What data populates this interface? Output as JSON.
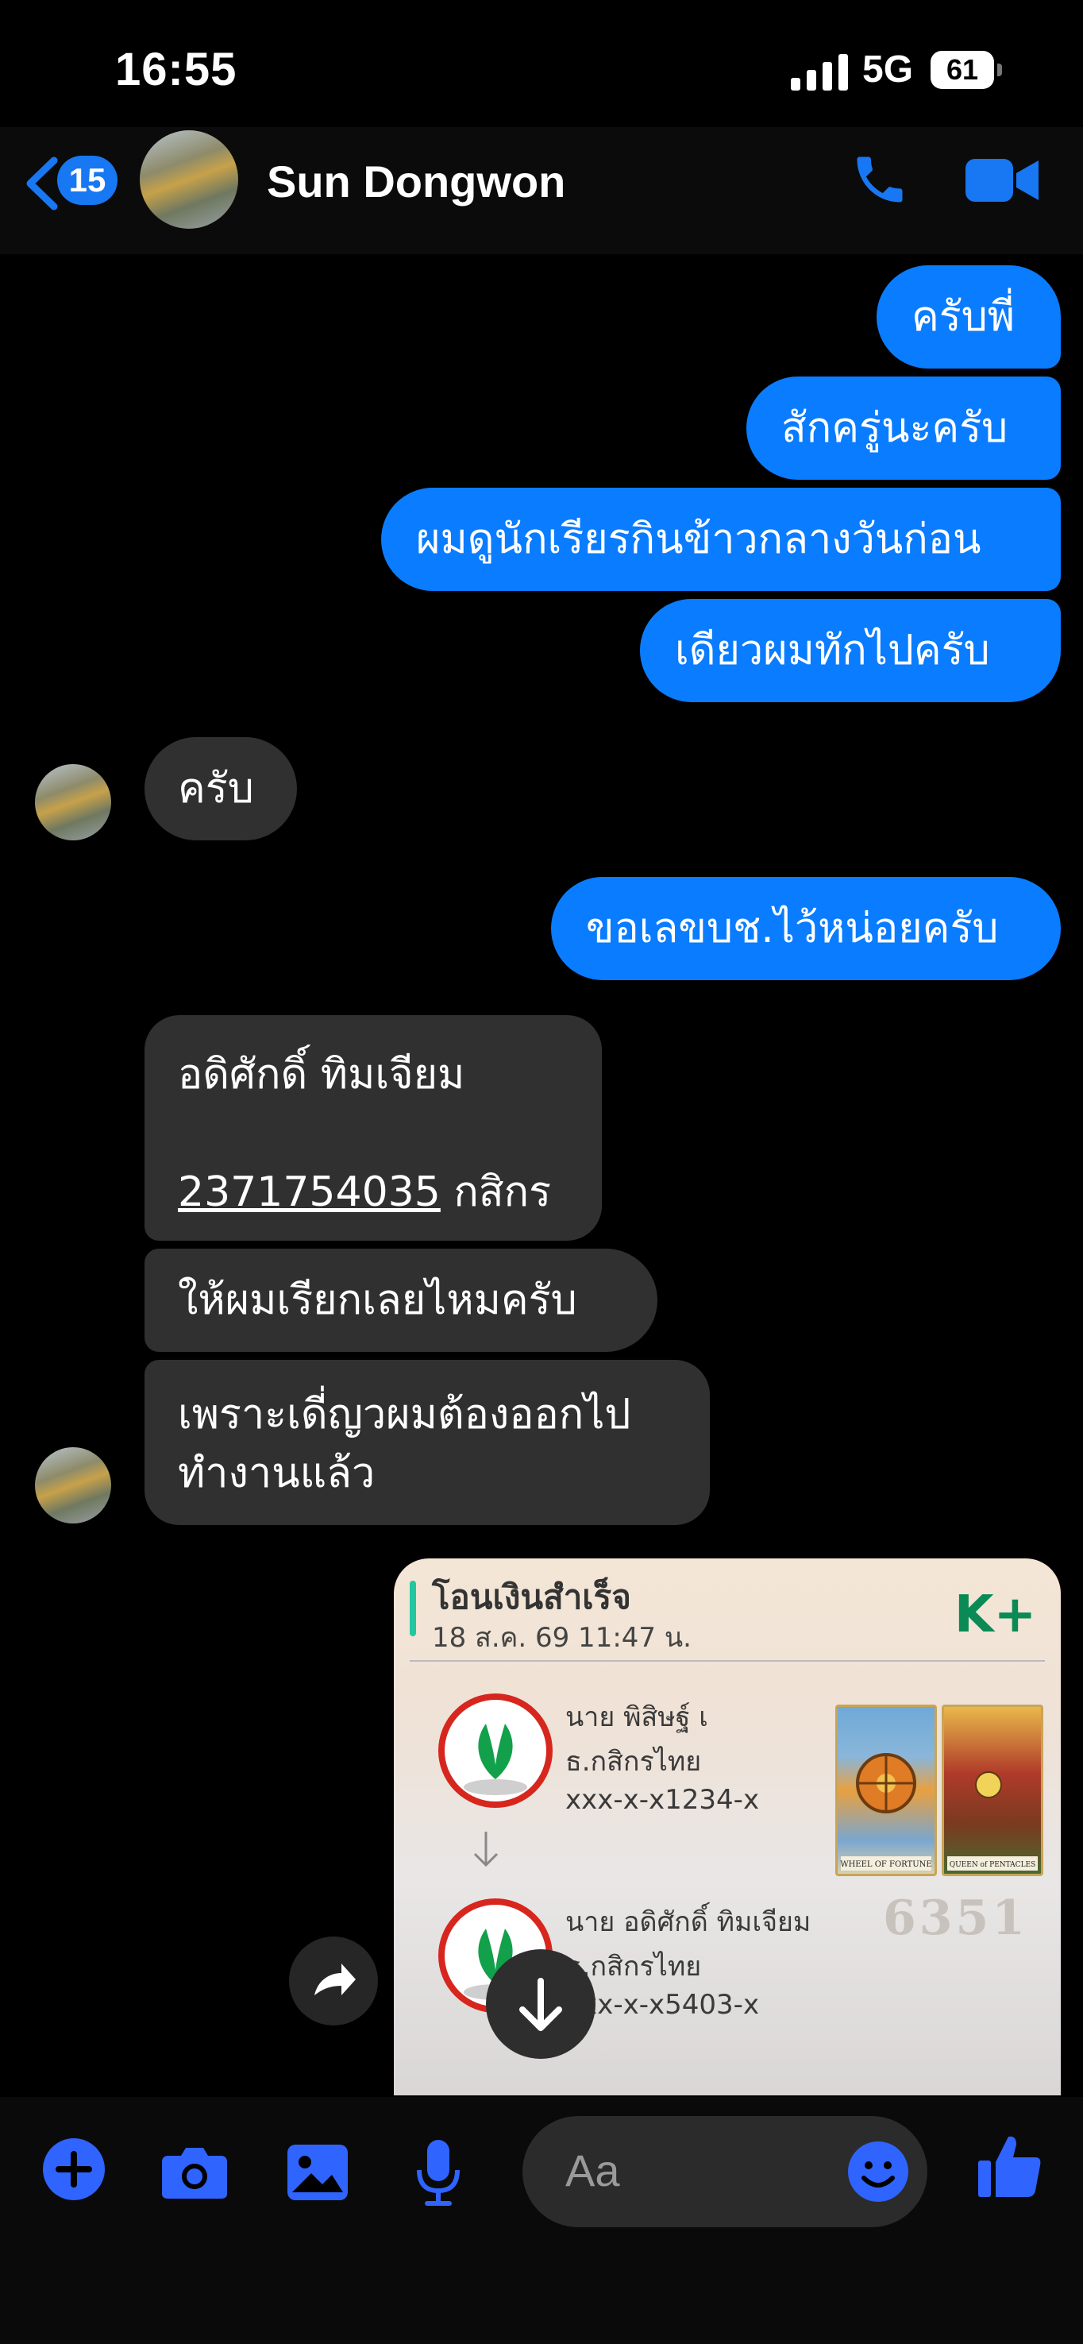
{
  "status": {
    "time": "16:55",
    "network": "5G",
    "battery": "61"
  },
  "header": {
    "unread_count": "15",
    "contact_name": "Sun Dongwon"
  },
  "messages": {
    "m1": "ครับพี่",
    "m2": "สักครู่นะครับ",
    "m3": "ผมดูนักเรียรกินข้าวกลางวันก่อน",
    "m4": "เดียวผมทักไปครับ",
    "m5": "ครับ",
    "m6": "ขอเลขบช.ไว้หน่อยครับ",
    "m7_line1": "อดิศักดิ์ ทิมเจียม",
    "m7_account": "2371754035",
    "m7_bank": " กสิกร",
    "m8": "ให้ผมเรียกเลยไหมครับ",
    "m9_line1": "เพราะเดี่ญวผมต้องออกไป",
    "m9_line2": "ทำงานแล้ว"
  },
  "transfer_card": {
    "title": "โอนเงินสำเร็จ",
    "datetime": "18 ส.ค. 69  11:47 น.",
    "brand": "K+",
    "sender_name": "นาย พิสิษฐ์ เ",
    "sender_bank": "ธ.กสิกรไทย",
    "sender_account": "xxx-x-x1234-x",
    "receiver_name": "นาย อดิศักดิ์ ทิมเจียม",
    "receiver_bank": "ธ.กสิกรไทย",
    "receiver_account": "xxx-x-x5403-x",
    "card1_label": "WHEEL OF FORTUNE",
    "card2_label": "QUEEN of PENTACLES",
    "watermark_number": "6351"
  },
  "composer": {
    "placeholder": "Aa"
  },
  "icons": [
    "back-icon",
    "phone-icon",
    "video-icon",
    "plus-icon",
    "camera-icon",
    "gallery-icon",
    "microphone-icon",
    "emoji-icon",
    "thumbs-up-icon",
    "share-icon",
    "arrow-down-icon"
  ],
  "colors": {
    "accent": "#0a7cff",
    "incoming": "#303030",
    "icon_blue": "#2f64ff"
  }
}
